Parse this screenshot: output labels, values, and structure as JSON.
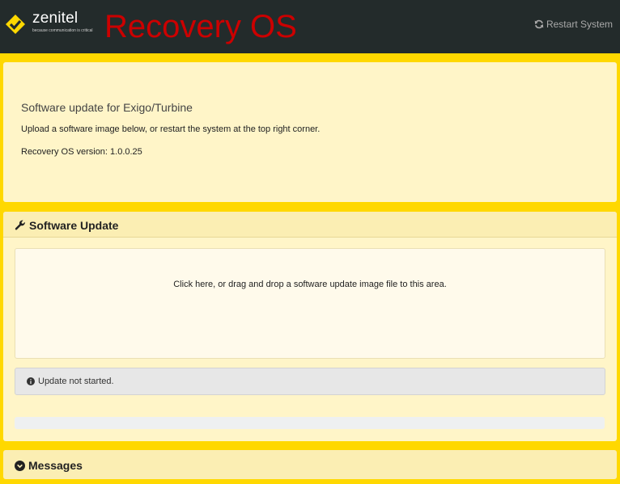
{
  "header": {
    "brand_name": "zenitel",
    "brand_tagline": "because communication is critical",
    "title": "Recovery OS",
    "restart_label": "Restart System",
    "logo_icon": "zenitel-logo-icon",
    "restart_icon": "refresh-icon"
  },
  "info": {
    "title": "Software update for Exigo/Turbine",
    "description": "Upload a software image below, or restart the system at the top right corner.",
    "version": "Recovery OS version: 1.0.0.25"
  },
  "software_update": {
    "heading": "Software Update",
    "heading_icon": "wrench-icon",
    "dropzone_text": "Click here, or drag and drop a software update image file to this area.",
    "status_text": "Update not started.",
    "status_icon": "info-circle-icon",
    "progress": 0
  },
  "messages": {
    "heading": "Messages",
    "icon": "chevron-down-circle-icon"
  },
  "colors": {
    "background": "#ffd800",
    "navbar": "#232b2b",
    "title_red": "#cc0000",
    "panel": "#fff5c8"
  }
}
